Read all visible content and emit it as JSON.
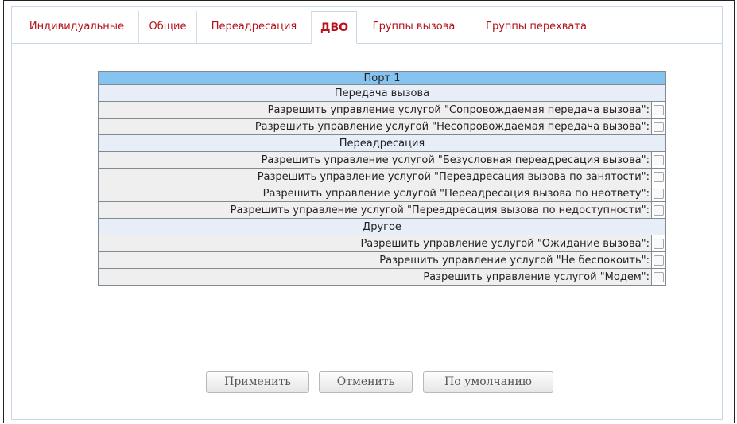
{
  "tabs": [
    {
      "label": "Индивидуальные",
      "active": false
    },
    {
      "label": "Общие",
      "active": false
    },
    {
      "label": "Переадресация",
      "active": false
    },
    {
      "label": "ДВО",
      "active": true
    },
    {
      "label": "Группы вызова",
      "active": false
    },
    {
      "label": "Группы перехвата",
      "active": false
    }
  ],
  "port_title": "Порт 1",
  "sections": [
    {
      "title": "Передача вызова",
      "options": [
        {
          "label": "Разрешить управление услугой \"Сопровождаемая передача вызова\":",
          "checked": false
        },
        {
          "label": "Разрешить управление услугой \"Несопровождаемая передача вызова\":",
          "checked": false
        }
      ]
    },
    {
      "title": "Переадресация",
      "options": [
        {
          "label": "Разрешить управление услугой \"Безусловная переадресация вызова\":",
          "checked": false
        },
        {
          "label": "Разрешить управление услугой \"Переадресация вызова по занятости\":",
          "checked": false
        },
        {
          "label": "Разрешить управление услугой \"Переадресация вызова по неответу\":",
          "checked": false
        },
        {
          "label": "Разрешить управление услугой \"Переадресация вызова по недоступности\":",
          "checked": false
        }
      ]
    },
    {
      "title": "Другое",
      "options": [
        {
          "label": "Разрешить управление услугой \"Ожидание вызова\":",
          "checked": false
        },
        {
          "label": "Разрешить управление услугой \"Не беспокоить\":",
          "checked": false
        },
        {
          "label": "Разрешить управление услугой \"Модем\":",
          "checked": false
        }
      ]
    }
  ],
  "buttons": {
    "apply": "Применить",
    "cancel": "Отменить",
    "default": "По умолчанию"
  },
  "colors": {
    "tab_text": "#b5121b",
    "port_header_bg": "#87c3ef",
    "section_bg": "#e7eef7",
    "label_bg": "#efefef",
    "grid_border": "#7f8a94"
  }
}
